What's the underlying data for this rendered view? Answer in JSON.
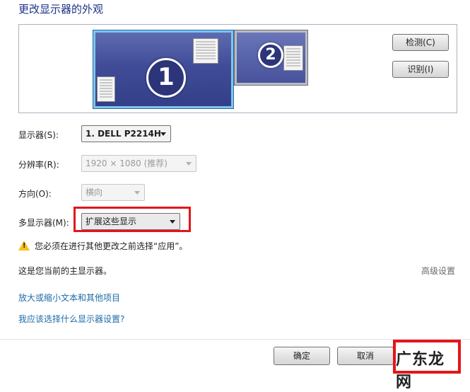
{
  "page": {
    "title": "更改显示器的外观"
  },
  "monitors": [
    {
      "number": "1",
      "selected": true
    },
    {
      "number": "2",
      "selected": false
    }
  ],
  "buttons": {
    "detect": "检测(C)",
    "identify": "识别(I)",
    "ok": "确定",
    "cancel": "取消"
  },
  "settings": {
    "display": {
      "label": "显示器(S):",
      "value": "1. DELL P2214H"
    },
    "resolution": {
      "label": "分辨率(R):",
      "value": "1920 × 1080 (推荐)",
      "enabled": false
    },
    "orientation": {
      "label": "方向(O):",
      "value": "横向",
      "enabled": false
    },
    "multiple_displays": {
      "label": "多显示器(M):",
      "value": "扩展这些显示"
    }
  },
  "warning": {
    "icon": "warning-icon",
    "text": "您必须在进行其他更改之前选择“应用”。"
  },
  "status": {
    "main_display": "这是您当前的主显示器。",
    "advanced_settings": "高级设置"
  },
  "links": {
    "zoom_text": "放大或缩小文本和其他项目",
    "which_settings": "我应该选择什么显示器设置?"
  },
  "watermark": {
    "text": "广东龙网"
  },
  "colors": {
    "title": "#1e3287",
    "link": "#1e6ba6",
    "highlight": "#e2161b",
    "selected_monitor_border": "#7cc6ee"
  }
}
